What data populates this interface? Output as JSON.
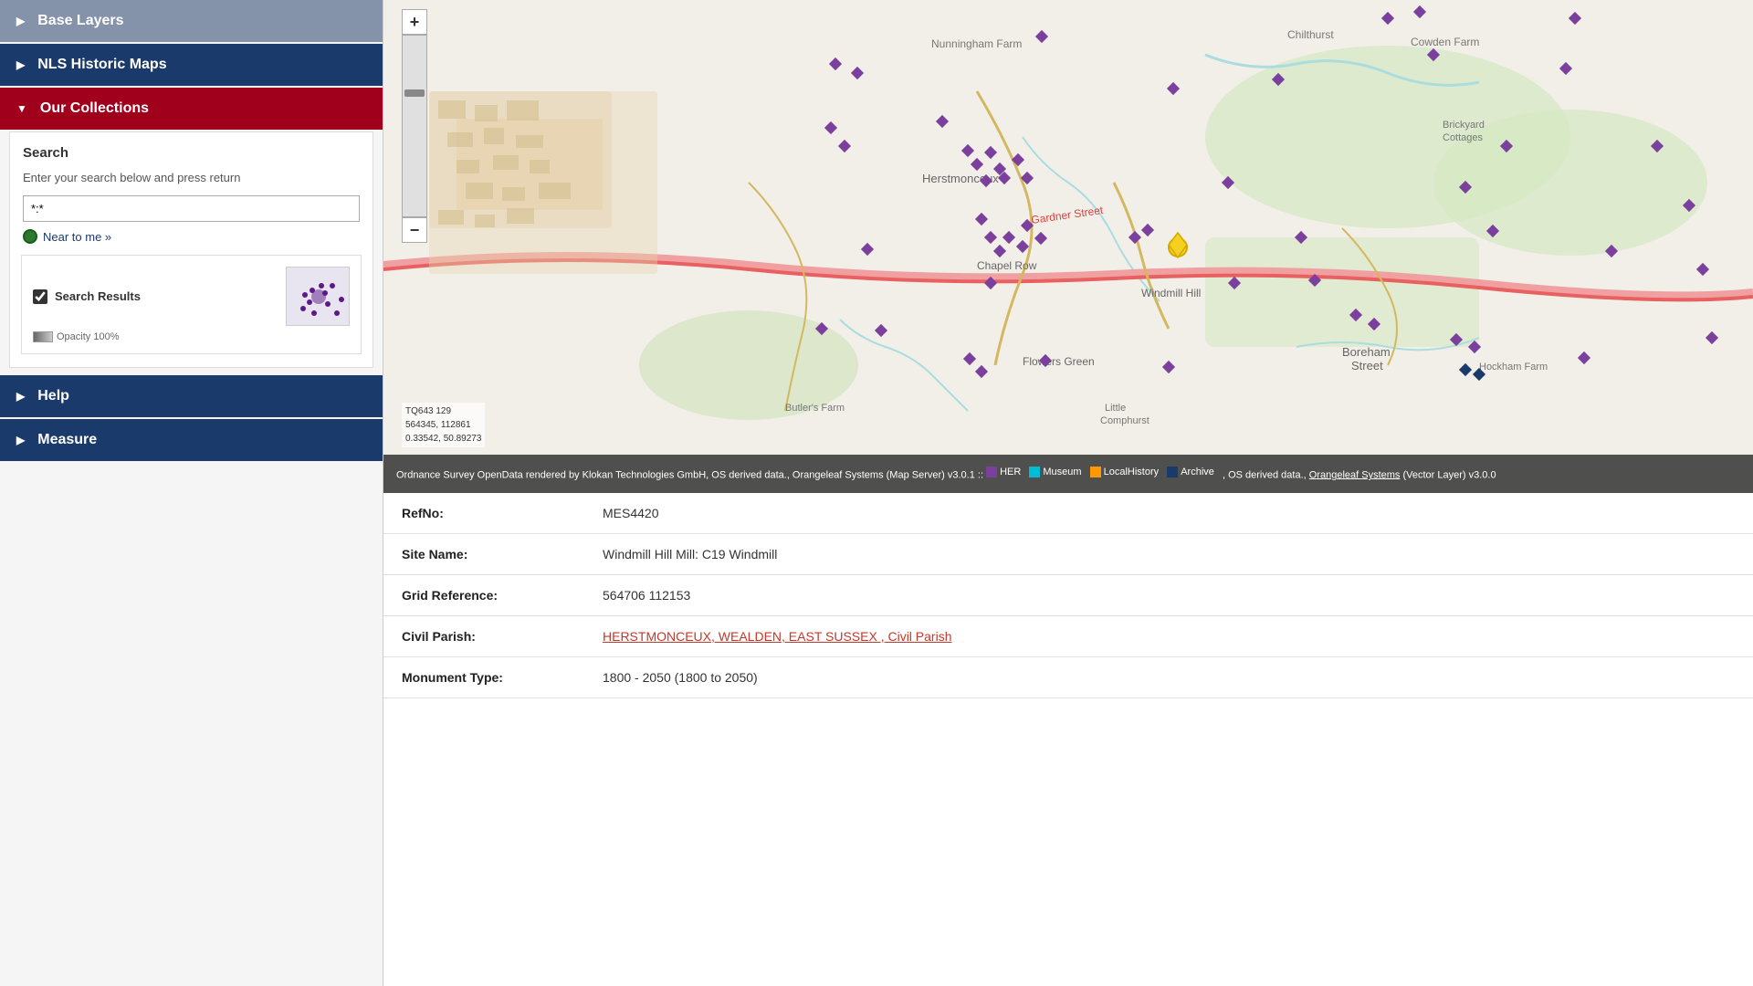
{
  "sidebar": {
    "base_layers_label": "Base Layers",
    "nls_label": "NLS Historic Maps",
    "our_collections_label": "Our Collections",
    "search": {
      "title": "Search",
      "description": "Enter your search below and press return",
      "input_value": "*:*",
      "near_to_me_label": "Near to me »"
    },
    "results": {
      "label": "Search Results",
      "opacity_label": "Opacity 100%"
    },
    "help_label": "Help",
    "measure_label": "Measure"
  },
  "map": {
    "coords_line1": "TQ643 129",
    "coords_line2": "564345, 112861",
    "coords_line3": "0.33542, 50.89273",
    "attribution": "Ordnance Survey OpenData rendered by Klokan Technologies GmbH, OS derived data., Orangeleaf Systems (Map Server) v3.0.1 :: ",
    "attribution2": " HER ",
    "attribution3": " Museum ",
    "attribution4": " LocalHistory ",
    "attribution5": " Archive ",
    "attribution6": ", OS derived data., ",
    "attribution7": "Orangeleaf Systems",
    "attribution8": " (Vector Layer) v3.0.0",
    "legend": {
      "her_color": "#7b3f9e",
      "museum_color": "#00bcd4",
      "localhistory_color": "#ff9800",
      "archive_color": "#1a3a6b"
    }
  },
  "record": {
    "refno_label": "RefNo:",
    "refno_value": "MES4420",
    "sitename_label": "Site Name:",
    "sitename_value": "Windmill Hill Mill: C19 Windmill",
    "gridref_label": "Grid Reference:",
    "gridref_value": "564706 112153",
    "parish_label": "Civil Parish:",
    "parish_value": "HERSTMONCEUX, WEALDEN, EAST SUSSEX , Civil Parish",
    "monument_label": "Monument Type:",
    "monument_value": "1800 - 2050 (1800 to 2050)"
  }
}
